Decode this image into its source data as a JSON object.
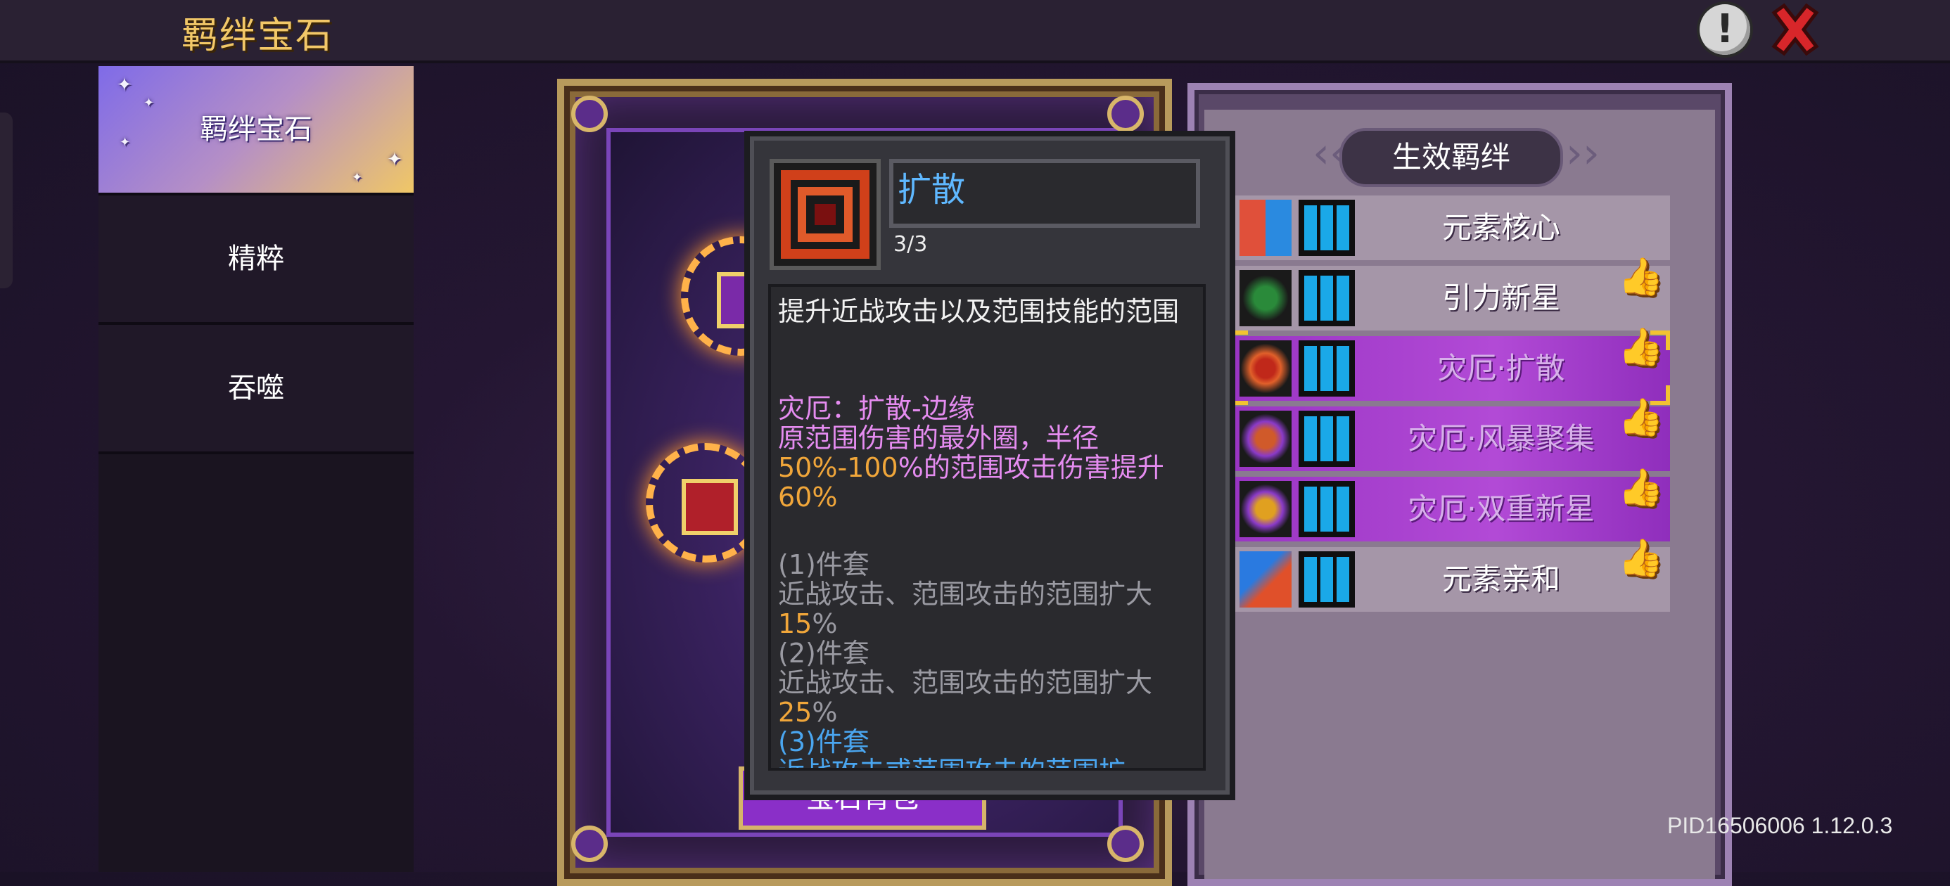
{
  "header": {
    "title": "羁绊宝石"
  },
  "sidebar": {
    "items": [
      {
        "label": "羁绊宝石",
        "active": true
      },
      {
        "label": "精粹",
        "active": false
      },
      {
        "label": "吞噬",
        "active": false
      }
    ]
  },
  "card": {
    "bag_button": "宝石背包"
  },
  "tooltip": {
    "name": "扩散",
    "count": "3/3",
    "desc": "提升近战攻击以及范围技能的范围",
    "bond_title": "灾厄：扩散-边缘",
    "bond_text": "原范围伤害的最外圈，半径",
    "bond_range_a": "50",
    "bond_range_sep": "%-100",
    "bond_range_b": "%的范围攻击伤害提升",
    "bond_bonus": "60",
    "pct": "%",
    "set1_label": "(1)件套",
    "set1_text": "近战攻击、范围攻击的范围扩大",
    "set1_value": "15",
    "set2_label": "(2)件套",
    "set2_text": "近战攻击、范围攻击的范围扩大",
    "set2_value": "25",
    "set3_label": "(3)件套",
    "set3_text": "近战攻击或范围攻击的范围扩"
  },
  "bonds_panel": {
    "title": "生效羁绊",
    "items": [
      {
        "name": "元素核心",
        "style": "grey",
        "thumb": false,
        "icon": "element-core-icon"
      },
      {
        "name": "引力新星",
        "style": "grey",
        "thumb": true,
        "icon": "gravity-nova-icon"
      },
      {
        "name": "灾厄·扩散",
        "style": "purple",
        "thumb": true,
        "selected": true,
        "icon": "calamity-spread-icon"
      },
      {
        "name": "灾厄·风暴聚集",
        "style": "purple",
        "thumb": true,
        "icon": "calamity-storm-icon"
      },
      {
        "name": "灾厄·双重新星",
        "style": "purple",
        "thumb": true,
        "icon": "calamity-double-nova-icon"
      },
      {
        "name": "元素亲和",
        "style": "grey",
        "thumb": true,
        "icon": "element-affinity-icon"
      }
    ]
  },
  "footer": {
    "pid": "PID16506006 1.12.0.3"
  },
  "colors": {
    "accent_gold": "#f2c868",
    "tooltip_name": "#5fb8ff",
    "bond_purple": "#b24ad6",
    "highlight": "#f0a63a"
  }
}
